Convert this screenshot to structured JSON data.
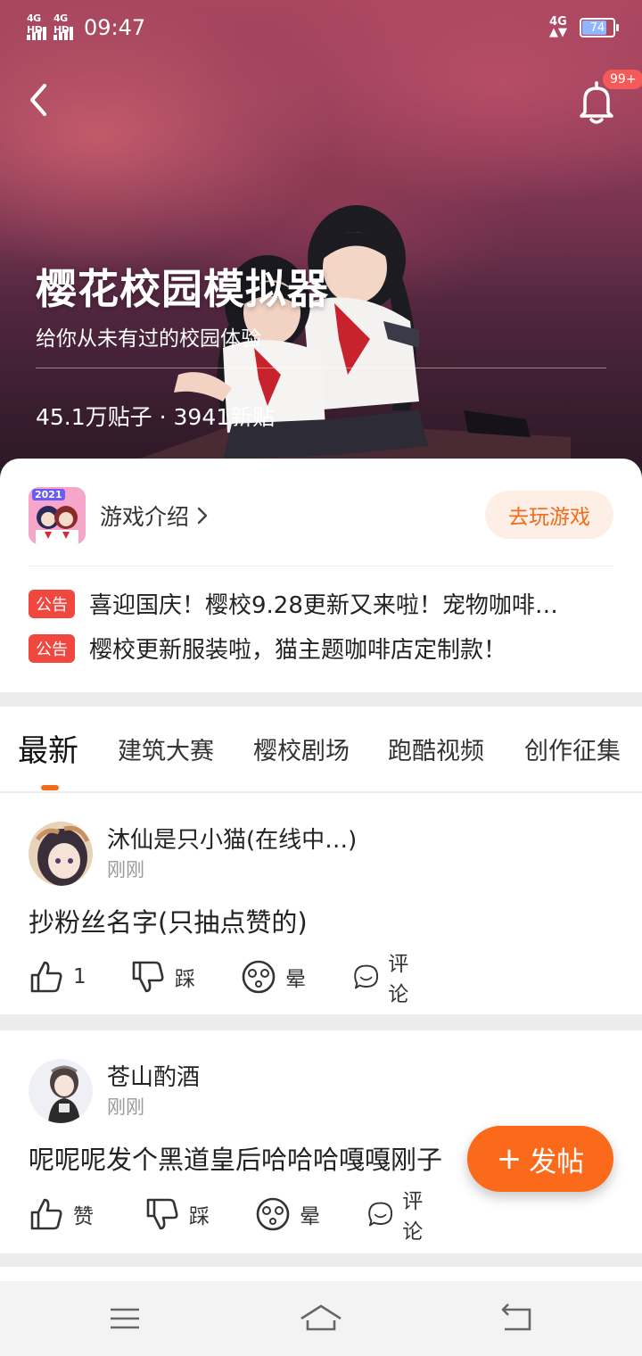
{
  "status_bar": {
    "signal1": "4G HD",
    "signal2": "4G HD",
    "time": "09:47",
    "net_type": "4G",
    "battery": "74"
  },
  "header": {
    "notification_badge": "99+",
    "title": "樱花校园模拟器",
    "subtitle": "给你从未有过的校园体验",
    "stats": "45.1万贴子 · 3941新贴"
  },
  "game_card": {
    "icon_year": "2021",
    "intro_label": "游戏介绍",
    "play_button": "去玩游戏",
    "notices": [
      {
        "tag": "公告",
        "text": "喜迎国庆！樱校9.28更新又来啦！宠物咖啡…"
      },
      {
        "tag": "公告",
        "text": "樱校更新服装啦，猫主题咖啡店定制款！"
      }
    ]
  },
  "tabs": [
    {
      "label": "最新",
      "active": true
    },
    {
      "label": "建筑大赛",
      "active": false
    },
    {
      "label": "樱校剧场",
      "active": false
    },
    {
      "label": "跑酷视频",
      "active": false
    },
    {
      "label": "创作征集",
      "active": false
    }
  ],
  "posts": [
    {
      "author": "沐仙是只小猫(在线中…)",
      "time": "刚刚",
      "text": "抄粉丝名字(只抽点赞的)",
      "like_label": "1",
      "dislike_label": "踩",
      "dizzy_label": "晕",
      "comment_label": "评论"
    },
    {
      "author": "苍山酌酒",
      "time": "刚刚",
      "text": "呢呢呢发个黑道皇后哈哈哈嘎嘎刚子",
      "like_label": "赞",
      "dislike_label": "踩",
      "dizzy_label": "晕",
      "comment_label": "评论"
    }
  ],
  "fab": {
    "label": "发帖",
    "plus": "+"
  },
  "colors": {
    "accent": "#fa6a1a",
    "notice_tag": "#f0473f",
    "badge": "#f45a5a"
  }
}
